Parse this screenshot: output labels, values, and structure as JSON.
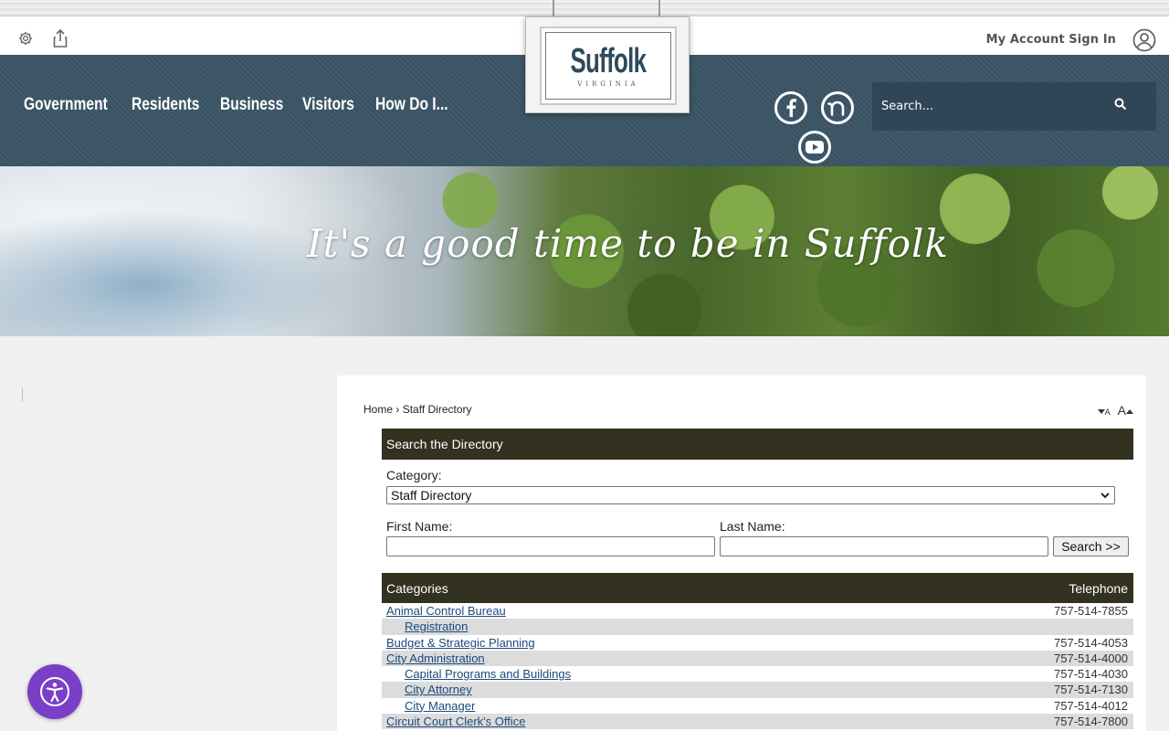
{
  "header": {
    "account_label": "My Account Sign In",
    "nav": [
      "Government",
      "Residents",
      "Business",
      "Visitors",
      "How Do I..."
    ],
    "logo_title": "Suffolk",
    "logo_subtitle": "VIRGINIA",
    "search_placeholder": "Search..."
  },
  "hero": {
    "tagline": "It's a good time to be in Suffolk"
  },
  "breadcrumb": {
    "home": "Home",
    "separator": "›",
    "current": "Staff Directory"
  },
  "font_controls": {
    "decrease": "A",
    "increase": "A"
  },
  "directory_search": {
    "heading": "Search the Directory",
    "category_label": "Category:",
    "category_selected": "Staff Directory",
    "first_name_label": "First Name:",
    "last_name_label": "Last Name:",
    "first_name_value": "",
    "last_name_value": "",
    "submit_label": "Search >>"
  },
  "results": {
    "col_categories": "Categories",
    "col_telephone": "Telephone",
    "rows": [
      {
        "name": "Animal Control Bureau",
        "phone": "757-514-7855",
        "indent": false
      },
      {
        "name": "Registration",
        "phone": "",
        "indent": true
      },
      {
        "name": "Budget & Strategic Planning",
        "phone": "757-514-4053",
        "indent": false
      },
      {
        "name": "City Administration",
        "phone": "757-514-4000",
        "indent": false
      },
      {
        "name": "Capital Programs and Buildings",
        "phone": "757-514-4030",
        "indent": true
      },
      {
        "name": "City Attorney",
        "phone": "757-514-7130",
        "indent": true
      },
      {
        "name": "City Manager",
        "phone": "757-514-4012",
        "indent": true
      },
      {
        "name": "Circuit Court Clerk's Office",
        "phone": "757-514-7800",
        "indent": false
      }
    ]
  },
  "colors": {
    "header_bg": "#3b5566",
    "panel_head_bg": "#333220",
    "link": "#1a4a7a",
    "accessibility_bg": "#7a3fc8"
  }
}
